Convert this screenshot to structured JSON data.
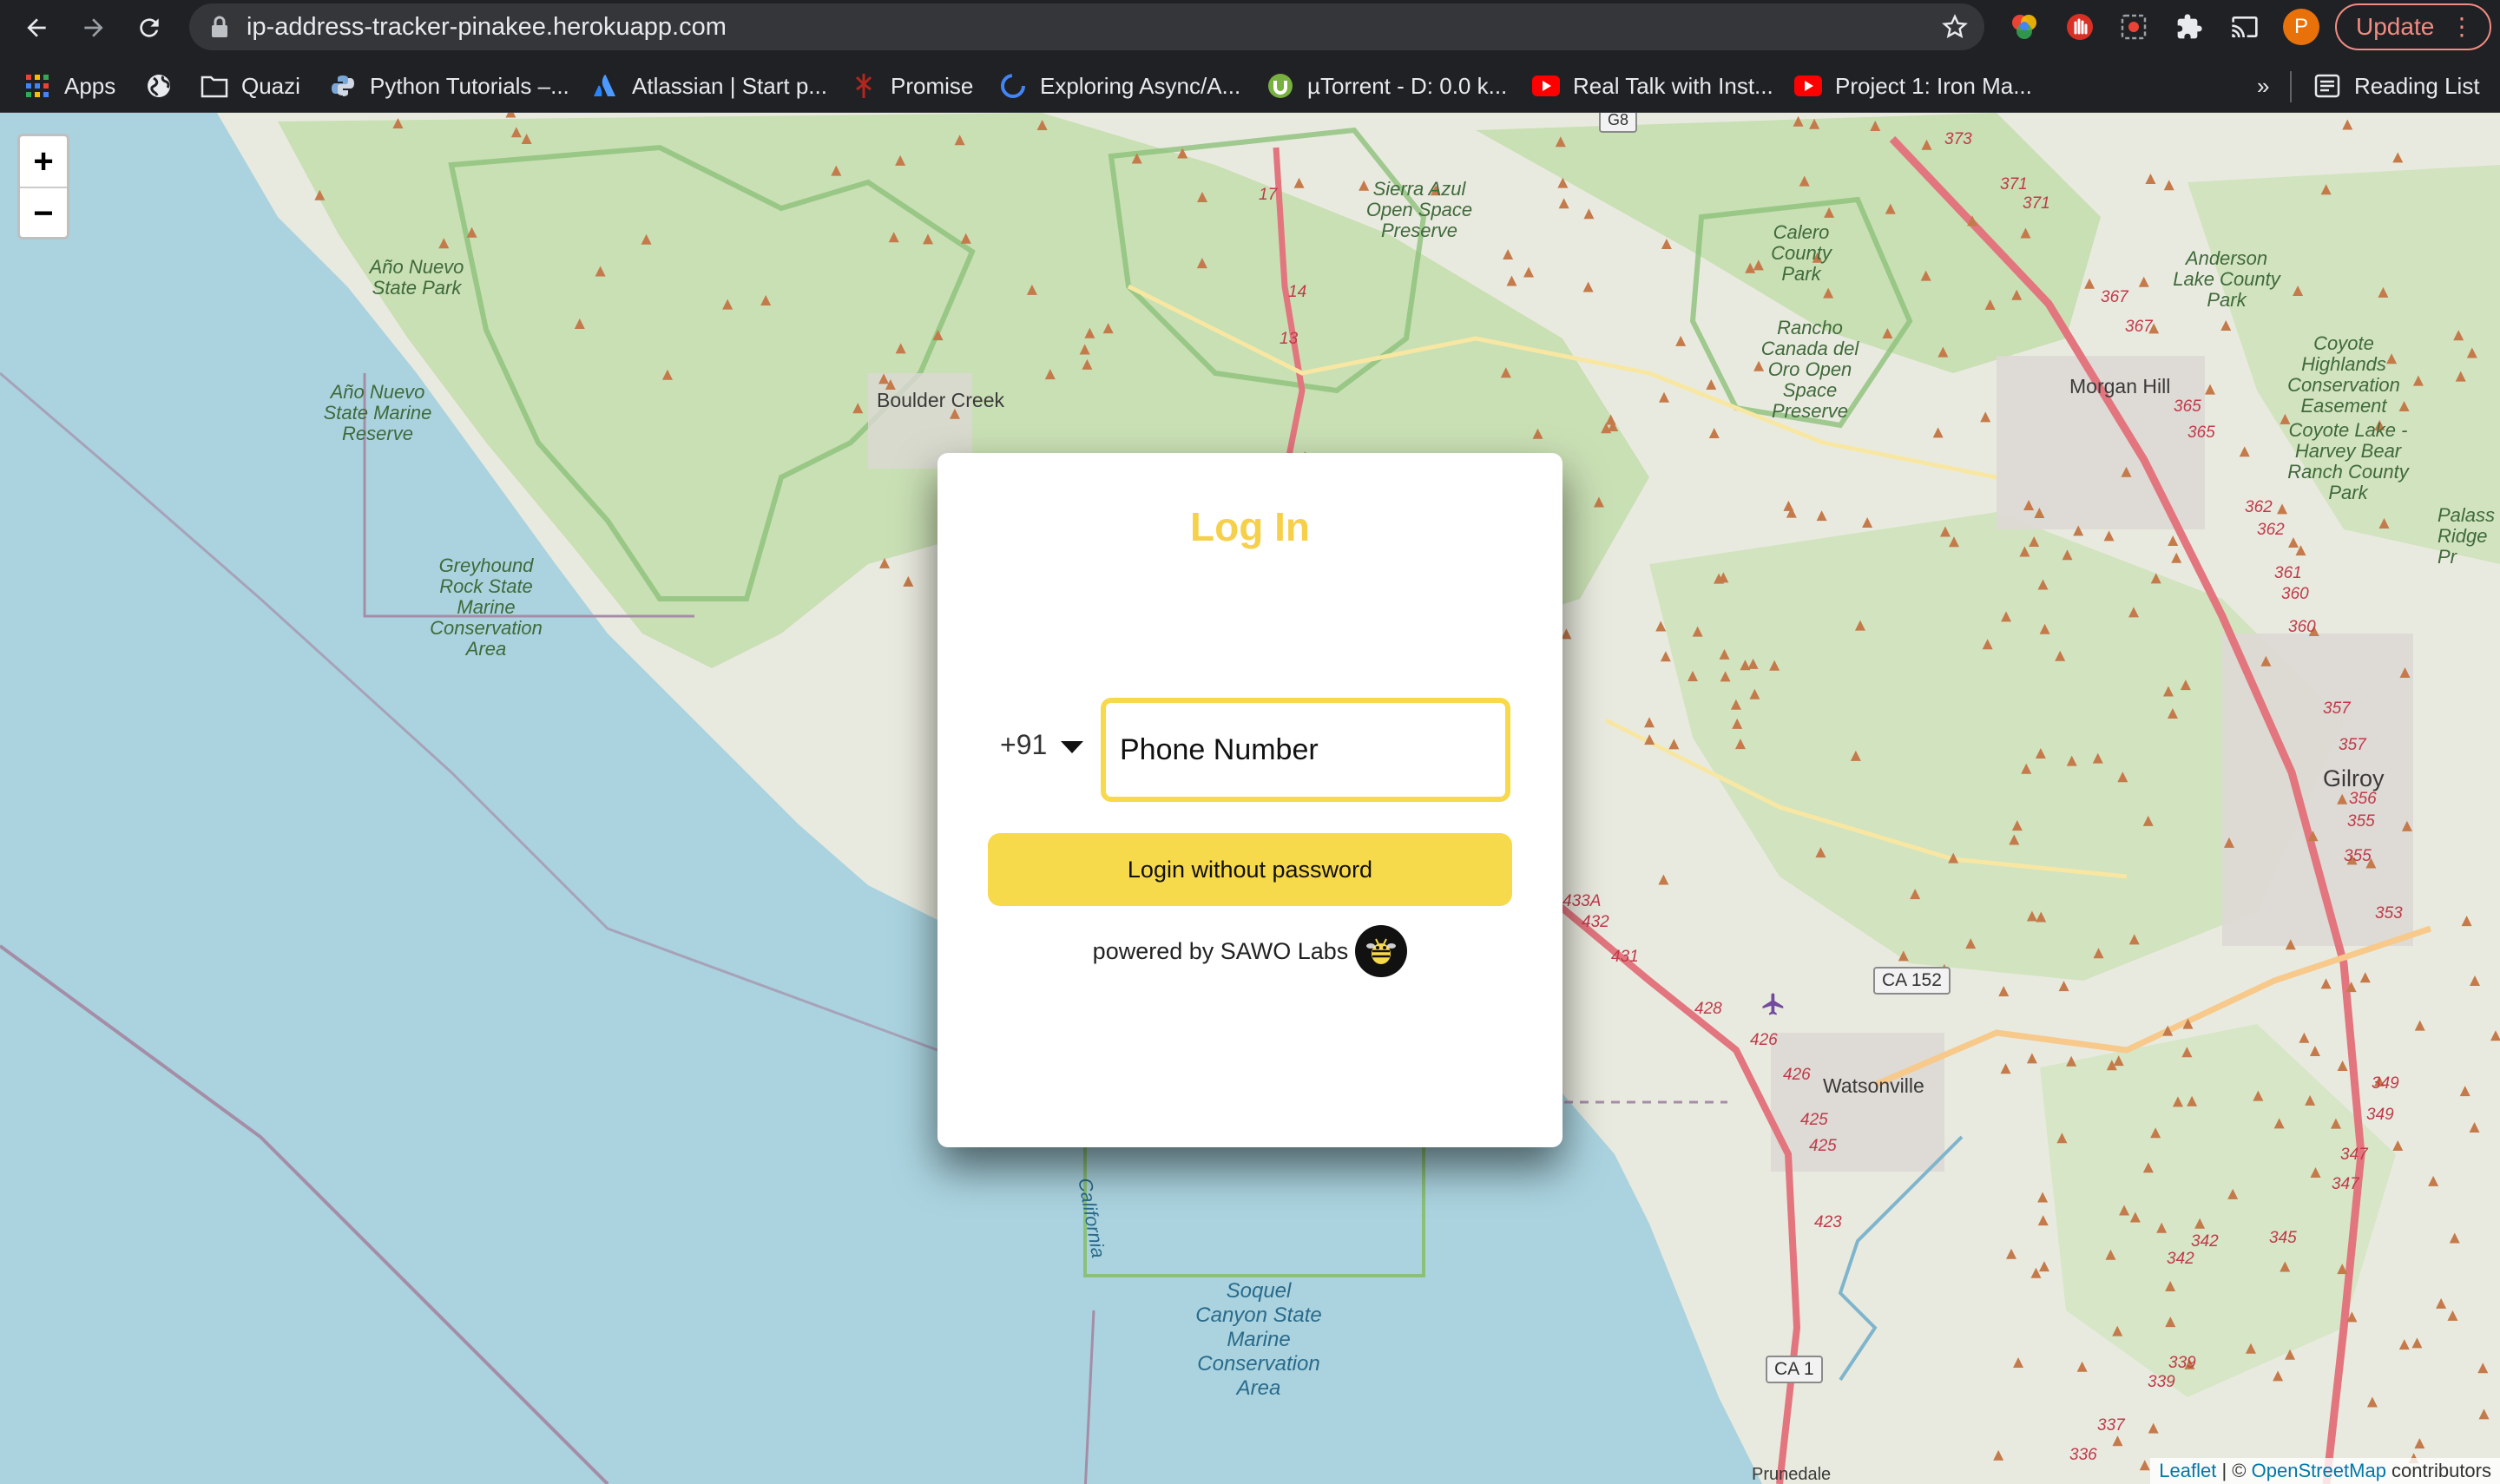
{
  "browser": {
    "url": "ip-address-tracker-pinakee.herokuapp.com",
    "profile_initial": "P",
    "update_label": "Update",
    "bookmarks": [
      {
        "label": "Apps",
        "icon": "apps-grid-icon"
      },
      {
        "label": "",
        "icon": "globe-icon"
      },
      {
        "label": "Quazi",
        "icon": "folder-icon"
      },
      {
        "label": "Python Tutorials –...",
        "icon": "python-icon"
      },
      {
        "label": "Atlassian | Start p...",
        "icon": "atlassian-icon"
      },
      {
        "label": "Promise",
        "icon": "promise-icon"
      },
      {
        "label": "Exploring Async/A...",
        "icon": "async-icon"
      },
      {
        "label": "µTorrent - D: 0.0 k...",
        "icon": "utorrent-icon"
      },
      {
        "label": "Real Talk with Inst...",
        "icon": "youtube-icon"
      },
      {
        "label": "Project 1: Iron Ma...",
        "icon": "youtube-icon"
      }
    ],
    "overflow_label": "»",
    "reading_list_label": "Reading List"
  },
  "map": {
    "zoom_in": "+",
    "zoom_out": "−",
    "labels": {
      "ano_nuevo_park": "Año Nuevo State Park",
      "ano_nuevo_reserve": "Año Nuevo State Marine Reserve",
      "greyhound": "Greyhound Rock State Marine Conservation Area",
      "sierra_azul": "Sierra Azul Open Space Preserve",
      "calero": "Calero County Park",
      "rancho_canada": "Rancho Canada del Oro Open Space Preserve",
      "anderson": "Anderson Lake County Park",
      "coyote_highlands": "Coyote Highlands Conservation Easement",
      "coyote_lake": "Coyote Lake - Harvey Bear Ranch County Park",
      "palassou": "Palass Ridge Pr",
      "soquel": "Soquel Canyon State Marine Conservation Area",
      "california": "California",
      "boulder_creek": "Boulder Creek",
      "morgan_hill": "Morgan Hill",
      "gilroy": "Gilroy",
      "watsonville": "Watsonville",
      "prunedale": "Prunedale",
      "ca152": "CA 152",
      "ca1": "CA 1",
      "us68": "G8"
    },
    "highway_numbers": [
      "373",
      "371",
      "371",
      "367",
      "367",
      "365",
      "365",
      "362",
      "362",
      "361",
      "360",
      "360",
      "357",
      "357",
      "356",
      "355",
      "355",
      "353",
      "349",
      "349",
      "347",
      "347",
      "345",
      "342",
      "342",
      "339",
      "339",
      "337",
      "336",
      "17",
      "14",
      "13",
      "433A",
      "432",
      "431",
      "428",
      "426",
      "426",
      "425",
      "425",
      "423"
    ],
    "attribution": {
      "leaflet": "Leaflet",
      "sep": " | © ",
      "osm": "OpenStreetMap",
      "suffix": " contributors"
    }
  },
  "login": {
    "title": "Log In",
    "country_code": "+91",
    "phone_placeholder": "Phone Number",
    "button_label": "Login without password",
    "powered_by": "powered by SAWO Labs"
  }
}
